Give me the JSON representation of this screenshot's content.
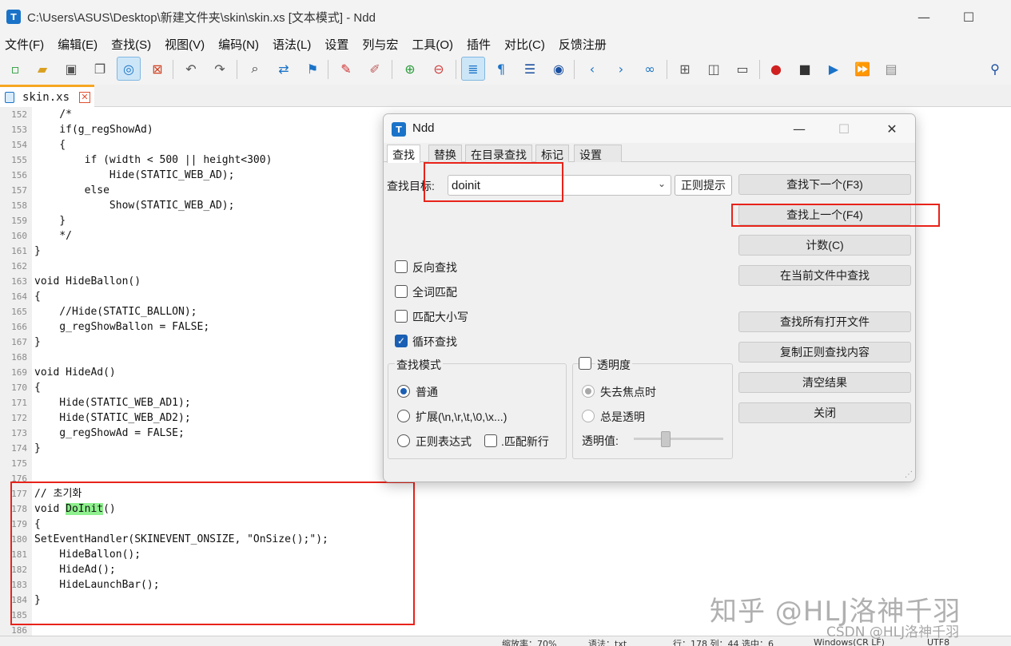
{
  "window": {
    "title": "C:\\Users\\ASUS\\Desktop\\新建文件夹\\skin\\skin.xs [文本模式] - Ndd",
    "app_icon_letter": "T"
  },
  "menu": [
    "文件(F)",
    "编辑(E)",
    "查找(S)",
    "视图(V)",
    "编码(N)",
    "语法(L)",
    "设置",
    "列与宏",
    "工具(O)",
    "插件",
    "对比(C)",
    "反馈注册"
  ],
  "tab": {
    "name": "skin.xs",
    "close_glyph": "✕"
  },
  "editor": {
    "lines": [
      {
        "n": "152",
        "code": "    /*"
      },
      {
        "n": "153",
        "code": "    if(g_regShowAd)"
      },
      {
        "n": "154",
        "code": "    {"
      },
      {
        "n": "155",
        "code": "        if (width < 500 || height<300)"
      },
      {
        "n": "156",
        "code": "            Hide(STATIC_WEB_AD);"
      },
      {
        "n": "157",
        "code": "        else"
      },
      {
        "n": "158",
        "code": "            Show(STATIC_WEB_AD);"
      },
      {
        "n": "159",
        "code": "    }"
      },
      {
        "n": "160",
        "code": "    */"
      },
      {
        "n": "161",
        "code": "}"
      },
      {
        "n": "162",
        "code": ""
      },
      {
        "n": "163",
        "code": "void HideBallon()"
      },
      {
        "n": "164",
        "code": "{"
      },
      {
        "n": "165",
        "code": "    //Hide(STATIC_BALLON);"
      },
      {
        "n": "166",
        "code": "    g_regShowBallon = FALSE;"
      },
      {
        "n": "167",
        "code": "}"
      },
      {
        "n": "168",
        "code": ""
      },
      {
        "n": "169",
        "code": "void HideAd()"
      },
      {
        "n": "170",
        "code": "{"
      },
      {
        "n": "171",
        "code": "    Hide(STATIC_WEB_AD1);"
      },
      {
        "n": "172",
        "code": "    Hide(STATIC_WEB_AD2);"
      },
      {
        "n": "173",
        "code": "    g_regShowAd = FALSE;"
      },
      {
        "n": "174",
        "code": "}"
      },
      {
        "n": "175",
        "code": ""
      },
      {
        "n": "176",
        "code": ""
      },
      {
        "n": "177",
        "code": "// 초기화"
      },
      {
        "n": "178",
        "code": "void ",
        "highlight": "DoInit",
        "rest": "()"
      },
      {
        "n": "179",
        "code": "{"
      },
      {
        "n": "180",
        "code": "SetEventHandler(SKINEVENT_ONSIZE, \"OnSize();\");"
      },
      {
        "n": "181",
        "code": "    HideBallon();"
      },
      {
        "n": "182",
        "code": "    HideAd();"
      },
      {
        "n": "183",
        "code": "    HideLaunchBar();"
      },
      {
        "n": "184",
        "code": "}"
      },
      {
        "n": "185",
        "code": ""
      },
      {
        "n": "186",
        "code": ""
      }
    ]
  },
  "status": {
    "zoom": "缩放率：70%",
    "syntax": "语法：txt",
    "position": "行：178 列：44 选中：6",
    "eol": "Windows(CR LF)",
    "encoding": "UTF8"
  },
  "watermark": {
    "main": "知乎 @HLJ洛神千羽",
    "sub": "CSDN @HLJ洛神千羽"
  },
  "dialog": {
    "title": "Ndd",
    "tabs": [
      "查找",
      "替换",
      "在目录查找",
      "标记",
      "设置"
    ],
    "find_label": "查找目标:",
    "find_value": "doinit",
    "regex_hint_button": "正则提示",
    "buttons": [
      "查找下一个(F3)",
      "查找上一个(F4)",
      "计数(C)",
      "在当前文件中查找",
      "查找所有打开文件",
      "复制正则查找内容",
      "清空结果",
      "关闭"
    ],
    "options": [
      {
        "label": "反向查找",
        "checked": false
      },
      {
        "label": "全词匹配",
        "checked": false
      },
      {
        "label": "匹配大小写",
        "checked": false
      },
      {
        "label": "循环查找",
        "checked": true
      }
    ],
    "mode_group": {
      "title": "查找模式",
      "normal": "普通",
      "extended": "扩展(\\n,\\r,\\t,\\0,\\x...)",
      "regex": "正则表达式",
      "match_newline": ".匹配新行"
    },
    "transparency_group": {
      "title": "透明度",
      "on_lose_focus": "失去焦点时",
      "always": "总是透明",
      "value_label": "透明值:"
    }
  }
}
